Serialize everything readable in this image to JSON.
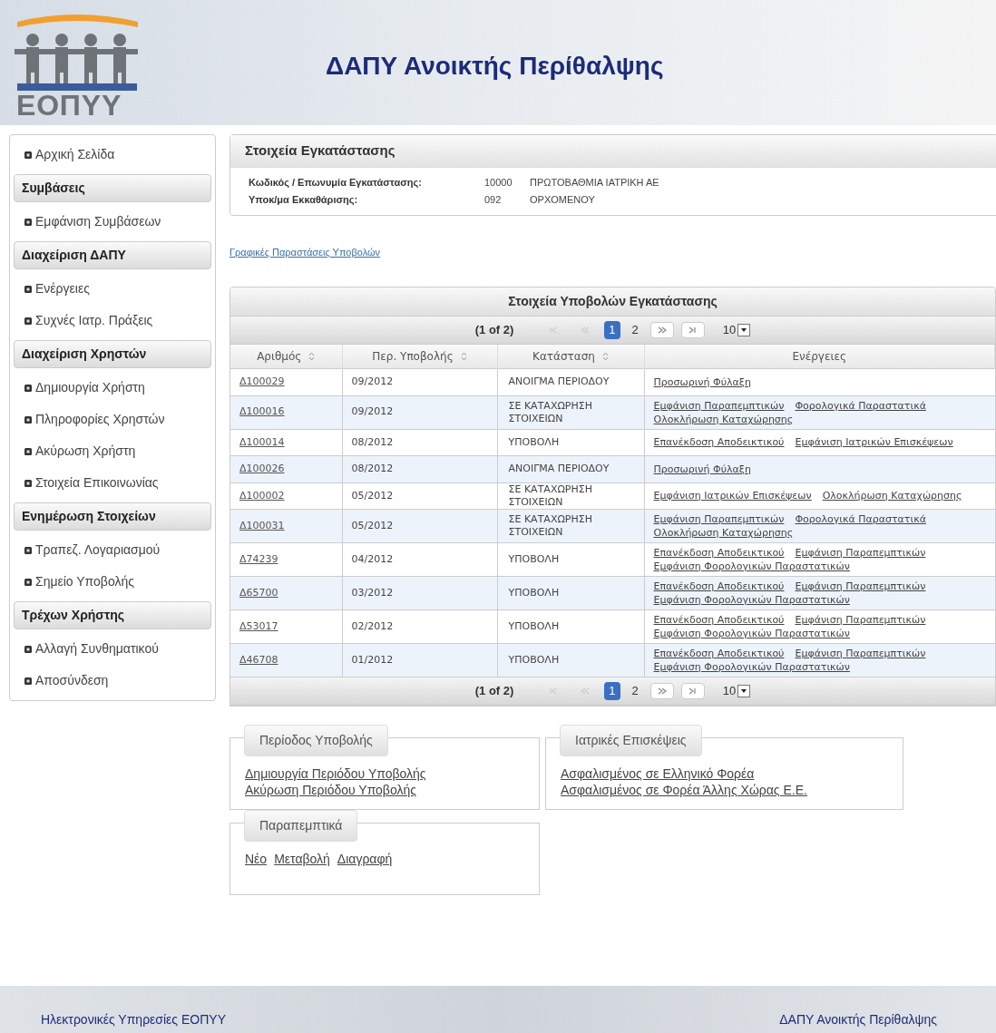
{
  "header": {
    "logo_text": "ΕΟΠΥΥ",
    "title": "ΔΑΠΥ Ανοικτής Περίθαλψης"
  },
  "sidebar": {
    "items": [
      {
        "kind": "link",
        "label": "Αρχική Σελίδα"
      },
      {
        "kind": "heading",
        "label": "Συμβάσεις"
      },
      {
        "kind": "link",
        "label": "Εμφάνιση Συμβάσεων"
      },
      {
        "kind": "heading",
        "label": "Διαχείριση ΔΑΠΥ"
      },
      {
        "kind": "link",
        "label": "Ενέργειες"
      },
      {
        "kind": "link",
        "label": "Συχνές Ιατρ. Πράξεις"
      },
      {
        "kind": "heading",
        "label": "Διαχείριση Χρηστών"
      },
      {
        "kind": "link",
        "label": "Δημιουργία Χρήστη"
      },
      {
        "kind": "link",
        "label": "Πληροφορίες Χρηστών"
      },
      {
        "kind": "link",
        "label": "Ακύρωση Χρήστη"
      },
      {
        "kind": "link",
        "label": "Στοιχεία Επικοινωνίας"
      },
      {
        "kind": "heading",
        "label": "Ενημέρωση Στοιχείων"
      },
      {
        "kind": "link",
        "label": "Τραπεζ. Λογαριασμού"
      },
      {
        "kind": "link",
        "label": "Σημείο Υποβολής"
      },
      {
        "kind": "heading",
        "label": "Τρέχων Χρήστης"
      },
      {
        "kind": "link",
        "label": "Αλλαγή Συνθηματικού"
      },
      {
        "kind": "link",
        "label": "Αποσύνδεση"
      }
    ]
  },
  "facility": {
    "title": "Στοιχεία Εγκατάστασης",
    "fields": [
      {
        "label": "Κωδικός / Επωνυμία Εγκατάστασης:",
        "code": "10000",
        "name": "ΠΡΩΤΟΒΑΘΜΙΑ ΙΑΤΡΙΚΗ ΑΕ"
      },
      {
        "label": "Υποκ/μα Εκκαθάρισης:",
        "code": "092",
        "name": "ΟΡΧΟΜΕΝΟΥ"
      }
    ]
  },
  "charts_link": "Γραφικές Παραστάσεις Υποβολών",
  "table": {
    "title": "Στοιχεία Υποβολών Εγκατάστασης",
    "pagers": [
      {
        "page_info": "(1 of 2)",
        "pages": [
          {
            "label": "1",
            "selected": true
          },
          {
            "label": "2",
            "selected": false
          }
        ],
        "first_disabled": true,
        "prev_disabled": true,
        "next_disabled": false,
        "last_disabled": false,
        "rows_per_page": "10"
      },
      {
        "page_info": "(1 of 2)",
        "pages": [
          {
            "label": "1",
            "selected": true
          },
          {
            "label": "2",
            "selected": false
          }
        ],
        "first_disabled": true,
        "prev_disabled": true,
        "next_disabled": false,
        "last_disabled": false,
        "rows_per_page": "10"
      }
    ],
    "columns": [
      {
        "label": "Αριθμός",
        "sortable": true
      },
      {
        "label": "Περ. Υποβολής",
        "sortable": true
      },
      {
        "label": "Κατάσταση",
        "sortable": true
      },
      {
        "label": "Ενέργειες",
        "sortable": false
      }
    ],
    "rows": [
      {
        "number": "Δ100029",
        "period": "09/2012",
        "status": "ΑΝΟΙΓΜΑ ΠΕΡΙΟΔΟΥ",
        "actions": [
          "Προσωρινή Φύλαξη"
        ]
      },
      {
        "number": "Δ100016",
        "period": "09/2012",
        "status": "ΣΕ ΚΑΤΑΧΩΡΗΣΗ ΣΤΟΙΧΕΙΩΝ",
        "actions": [
          "Εμφάνιση Παραπεμπτικών",
          "Φορολογικά Παραστατικά",
          "Ολοκλήρωση Καταχώρησης"
        ]
      },
      {
        "number": "Δ100014",
        "period": "08/2012",
        "status": "ΥΠΟΒΟΛΗ",
        "actions": [
          "Επανέκδοση Αποδεικτικού",
          "Εμφάνιση Ιατρικών Επισκέψεων"
        ]
      },
      {
        "number": "Δ100026",
        "period": "08/2012",
        "status": "ΑΝΟΙΓΜΑ ΠΕΡΙΟΔΟΥ",
        "actions": [
          "Προσωρινή Φύλαξη"
        ]
      },
      {
        "number": "Δ100002",
        "period": "05/2012",
        "status": "ΣΕ ΚΑΤΑΧΩΡΗΣΗ ΣΤΟΙΧΕΙΩΝ",
        "actions": [
          "Εμφάνιση Ιατρικών Επισκέψεων",
          "Ολοκλήρωση Καταχώρησης"
        ]
      },
      {
        "number": "Δ100031",
        "period": "05/2012",
        "status": "ΣΕ ΚΑΤΑΧΩΡΗΣΗ ΣΤΟΙΧΕΙΩΝ",
        "actions": [
          "Εμφάνιση Παραπεμπτικών",
          "Φορολογικά Παραστατικά",
          "Ολοκλήρωση Καταχώρησης"
        ]
      },
      {
        "number": "Δ74239",
        "period": "04/2012",
        "status": "ΥΠΟΒΟΛΗ",
        "actions": [
          "Επανέκδοση Αποδεικτικού",
          "Εμφάνιση Παραπεμπτικών",
          "Εμφάνιση Φορολογικών Παραστατικών"
        ]
      },
      {
        "number": "Δ65700",
        "period": "03/2012",
        "status": "ΥΠΟΒΟΛΗ",
        "actions": [
          "Επανέκδοση Αποδεικτικού",
          "Εμφάνιση Παραπεμπτικών",
          "Εμφάνιση Φορολογικών Παραστατικών"
        ]
      },
      {
        "number": "Δ53017",
        "period": "02/2012",
        "status": "ΥΠΟΒΟΛΗ",
        "actions": [
          "Επανέκδοση Αποδεικτικού",
          "Εμφάνιση Παραπεμπτικών",
          "Εμφάνιση Φορολογικών Παραστατικών"
        ]
      },
      {
        "number": "Δ46708",
        "period": "01/2012",
        "status": "ΥΠΟΒΟΛΗ",
        "actions": [
          "Επανέκδοση Αποδεικτικού",
          "Εμφάνιση Παραπεμπτικών",
          "Εμφάνιση Φορολογικών Παραστατικών"
        ]
      }
    ]
  },
  "panels": [
    {
      "title": "Περίοδος Υποβολής",
      "kind": "stacked",
      "links": [
        "Δημιουργία Περιόδου Υποβολής",
        "Ακύρωση Περιόδου Υποβολής"
      ]
    },
    {
      "title": "Ιατρικές Επισκέψεις",
      "kind": "stacked",
      "links": [
        "Ασφαλισμένος σε Ελληνικό Φορέα",
        "Ασφαλισμένος σε Φορέα Άλλης Χώρας Ε.Ε."
      ]
    },
    {
      "title": "Παραπεμπτικά",
      "kind": "inline",
      "links": [
        "Νέο",
        "Μεταβολή",
        "Διαγραφή"
      ]
    }
  ],
  "footer": {
    "left": "Ηλεκτρονικές Υπηρεσίες ΕΟΠΥΥ",
    "right": "ΔΑΠΥ Ανοικτής Περίθαλψης"
  }
}
